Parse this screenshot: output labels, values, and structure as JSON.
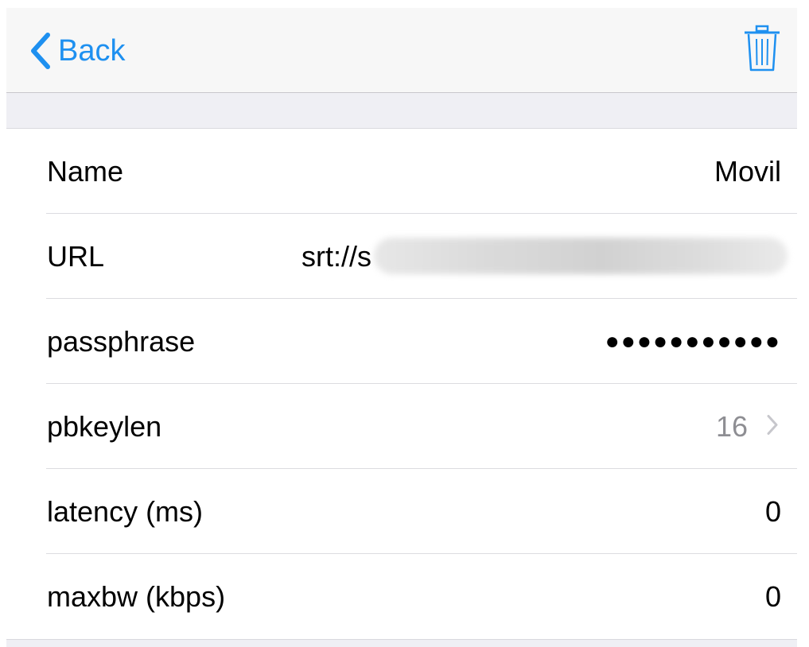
{
  "navbar": {
    "back_label": "Back",
    "back_icon": "chevron-left-icon",
    "trash_icon": "trash-icon",
    "accent_color": "#1e90f0"
  },
  "rows": [
    {
      "label": "Name",
      "value": "Movil"
    },
    {
      "label": "URL",
      "value": "srt://s"
    },
    {
      "label": "passphrase",
      "value": "●●●●●●●●●●●"
    },
    {
      "label": "pbkeylen",
      "value": "16"
    },
    {
      "label": "latency (ms)",
      "value": "0"
    },
    {
      "label": "maxbw (kbps)",
      "value": "0"
    }
  ]
}
